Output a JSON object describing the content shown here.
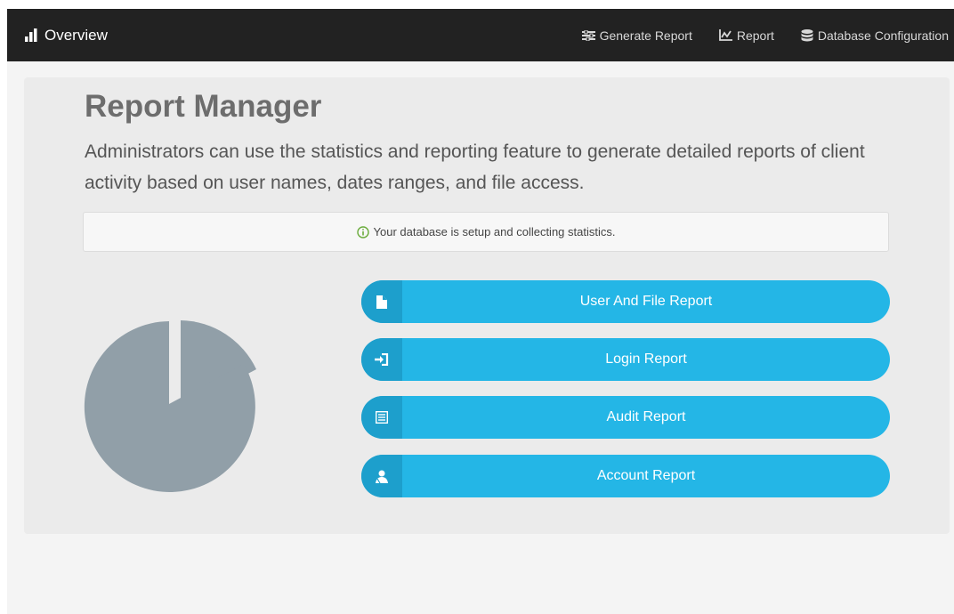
{
  "navbar": {
    "brand_label": "Overview",
    "brand_icon": "bar-chart-icon",
    "links": [
      {
        "label": "Generate Report",
        "icon": "sliders-icon"
      },
      {
        "label": "Report",
        "icon": "line-chart-icon"
      },
      {
        "label": "Database Configuration",
        "icon": "database-icon"
      }
    ]
  },
  "main": {
    "title": "Report Manager",
    "lead": "Administrators can use the statistics and reporting feature to generate detailed reports of client activity based on user names, dates ranges, and file access.",
    "alert_text": "Your database is setup and collecting statistics.",
    "alert_icon": "info-circle-icon",
    "illustration": "pie-chart-icon",
    "buttons": [
      {
        "label": "User And File Report",
        "icon": "file-icon"
      },
      {
        "label": "Login Report",
        "icon": "login-icon"
      },
      {
        "label": "Audit Report",
        "icon": "list-alt-icon"
      },
      {
        "label": "Account Report",
        "icon": "user-account-icon"
      }
    ]
  },
  "colors": {
    "navbar_bg": "#222222",
    "page_bg": "#f4f4f4",
    "panel_bg": "#ebebeb",
    "button_bg": "#24b6e6",
    "button_icon_bg": "#1d9fcc",
    "pie_color": "#919fa8",
    "alert_icon_color": "#6aab3b"
  }
}
